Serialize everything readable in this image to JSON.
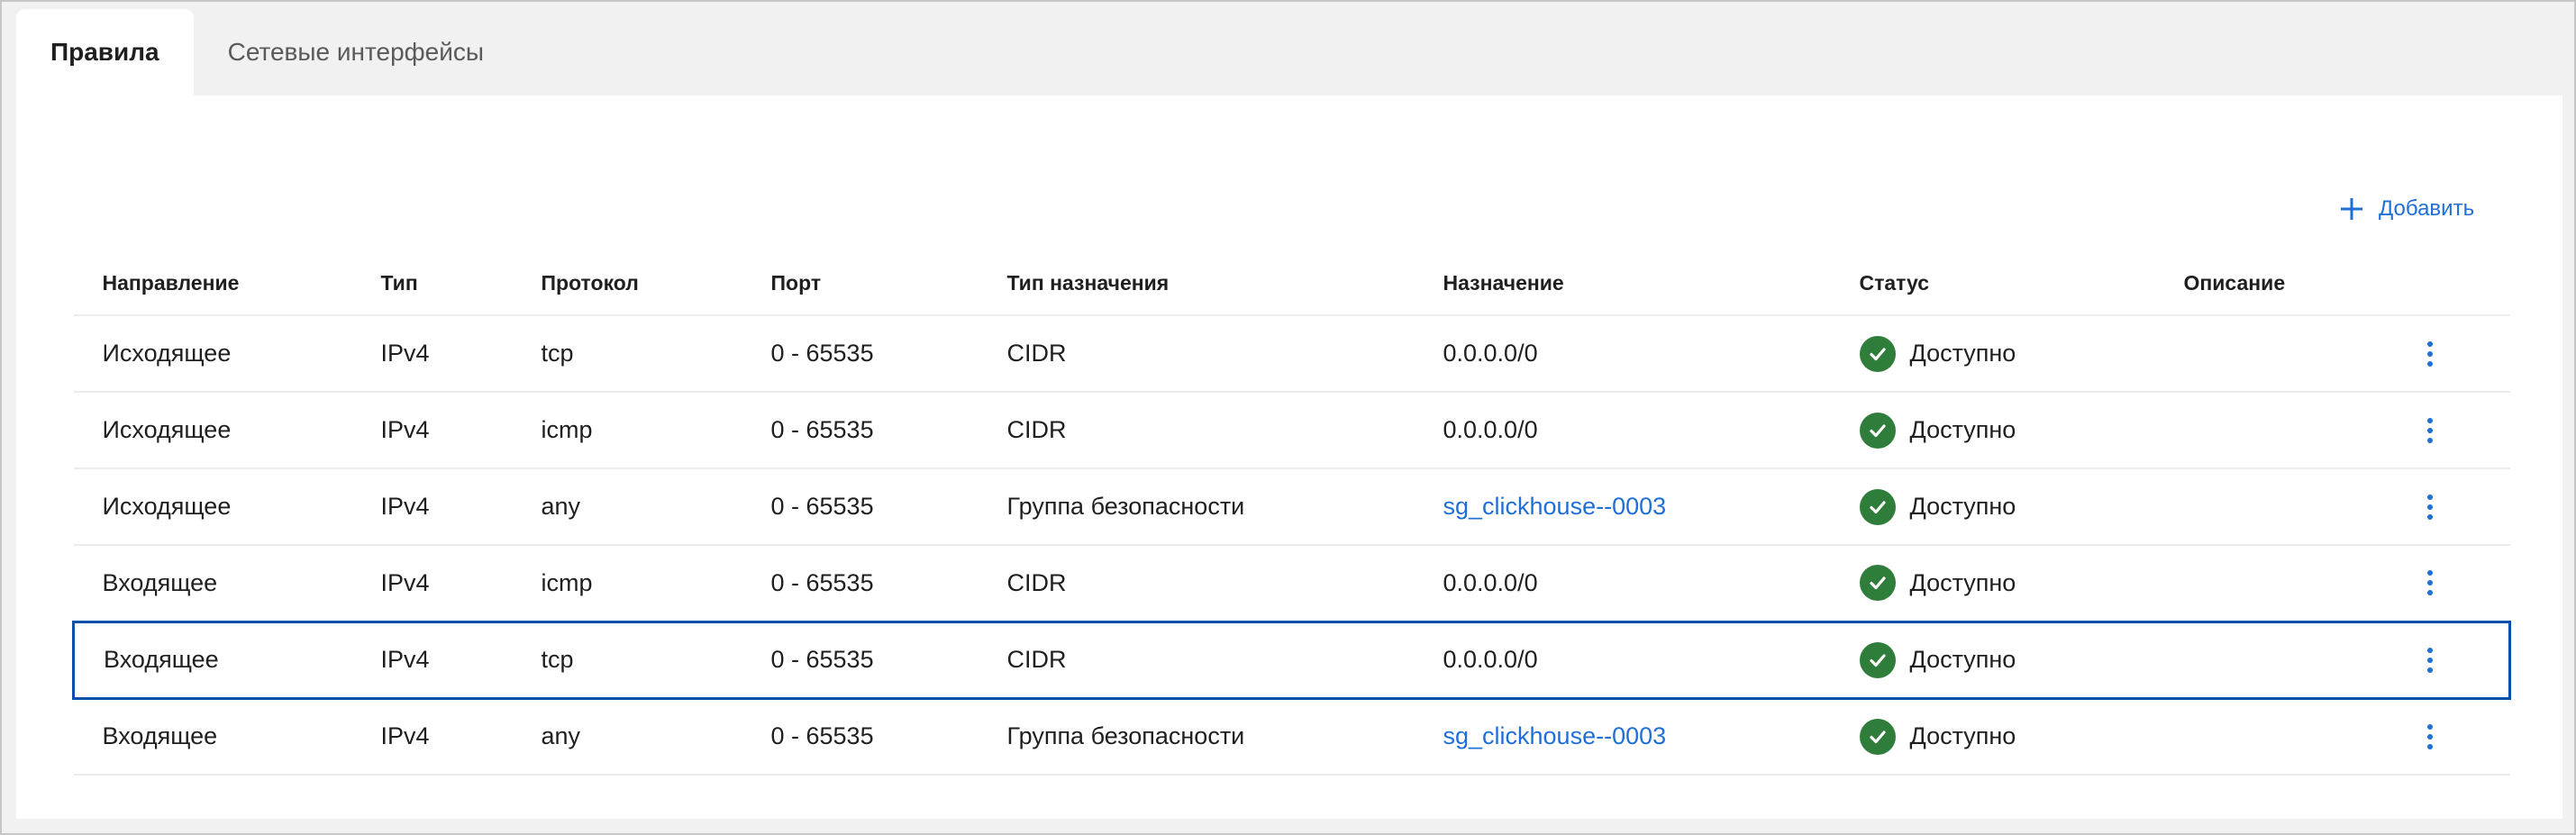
{
  "tabs": [
    {
      "label": "Правила",
      "active": true
    },
    {
      "label": "Сетевые интерфейсы",
      "active": false
    }
  ],
  "toolbar": {
    "add_label": "Добавить",
    "add_icon": "plus-icon"
  },
  "table": {
    "columns": [
      "Направление",
      "Тип",
      "Протокол",
      "Порт",
      "Тип назначения",
      "Назначение",
      "Статус",
      "Описание"
    ],
    "rows": [
      {
        "direction": "Исходящее",
        "type": "IPv4",
        "protocol": "tcp",
        "port": "0 - 65535",
        "dest_type": "CIDR",
        "destination": "0.0.0.0/0",
        "destination_is_link": false,
        "status": "Доступно",
        "description": "",
        "selected": false
      },
      {
        "direction": "Исходящее",
        "type": "IPv4",
        "protocol": "icmp",
        "port": "0 - 65535",
        "dest_type": "CIDR",
        "destination": "0.0.0.0/0",
        "destination_is_link": false,
        "status": "Доступно",
        "description": "",
        "selected": false
      },
      {
        "direction": "Исходящее",
        "type": "IPv4",
        "protocol": "any",
        "port": "0 - 65535",
        "dest_type": "Группа безопасности",
        "destination": "sg_clickhouse--0003",
        "destination_is_link": true,
        "status": "Доступно",
        "description": "",
        "selected": false
      },
      {
        "direction": "Входящее",
        "type": "IPv4",
        "protocol": "icmp",
        "port": "0 - 65535",
        "dest_type": "CIDR",
        "destination": "0.0.0.0/0",
        "destination_is_link": false,
        "status": "Доступно",
        "description": "",
        "selected": false
      },
      {
        "direction": "Входящее",
        "type": "IPv4",
        "protocol": "tcp",
        "port": "0 - 65535",
        "dest_type": "CIDR",
        "destination": "0.0.0.0/0",
        "destination_is_link": false,
        "status": "Доступно",
        "description": "",
        "selected": true
      },
      {
        "direction": "Входящее",
        "type": "IPv4",
        "protocol": "any",
        "port": "0 - 65535",
        "dest_type": "Группа безопасности",
        "destination": "sg_clickhouse--0003",
        "destination_is_link": true,
        "status": "Доступно",
        "description": "",
        "selected": false
      }
    ]
  },
  "colors": {
    "accent": "#1f6fd6",
    "status_ok": "#2f7d3a",
    "selected_border": "#0b4fa8",
    "frame_bg": "#f1f1f2"
  },
  "icons": {
    "status": "check-circle-icon",
    "row_menu": "more-vertical-icon"
  }
}
